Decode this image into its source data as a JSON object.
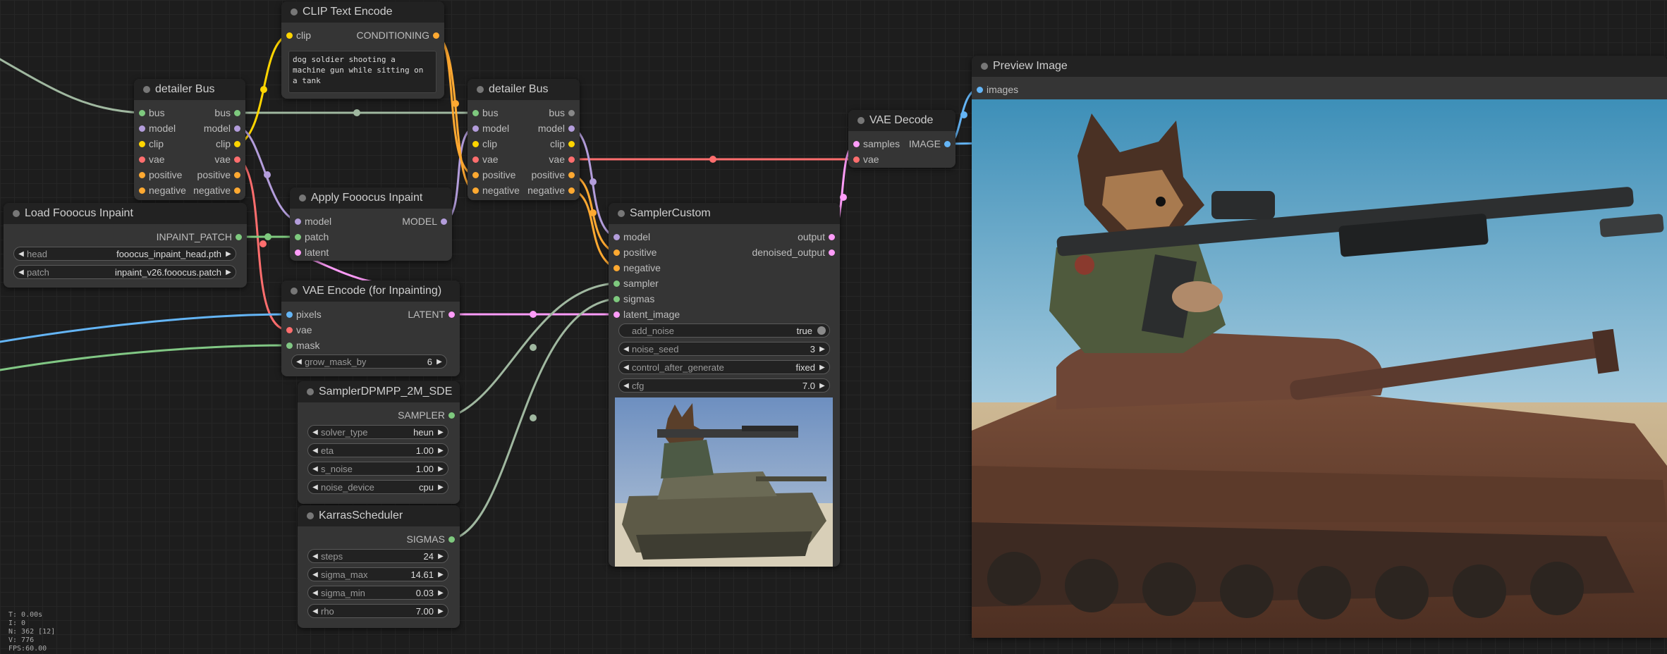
{
  "colors": {
    "bus": "#a0b8a0",
    "model": "#b39ddb",
    "clip": "#ffd500",
    "vae": "#ff6e6e",
    "conditioning": "#ffa931",
    "latent": "#ff9cf9",
    "image": "#64b5f6",
    "inpaint_patch": "#7ec97e",
    "mask": "#81c784",
    "sampler": "#a0b8a0",
    "sigmas": "#a0b8a0"
  },
  "nodes": {
    "clip_text_encode": {
      "title": "CLIP Text Encode",
      "inputs": [
        "clip"
      ],
      "outputs": [
        "CONDITIONING"
      ],
      "text": "dog soldier shooting a machine gun while sitting on a tank"
    },
    "detailer_bus_1": {
      "title": "detailer Bus",
      "inputs": [
        "bus",
        "model",
        "clip",
        "vae",
        "positive",
        "negative"
      ],
      "outputs": [
        "bus",
        "model",
        "clip",
        "vae",
        "positive",
        "negative"
      ]
    },
    "detailer_bus_2": {
      "title": "detailer Bus",
      "inputs": [
        "bus",
        "model",
        "clip",
        "vae",
        "positive",
        "negative"
      ],
      "outputs": [
        "bus",
        "model",
        "clip",
        "vae",
        "positive",
        "negative"
      ]
    },
    "load_fooocus_inpaint": {
      "title": "Load Fooocus Inpaint",
      "outputs": [
        "INPAINT_PATCH"
      ],
      "widgets": [
        {
          "label": "head",
          "value": "fooocus_inpaint_head.pth"
        },
        {
          "label": "patch",
          "value": "inpaint_v26.fooocus.patch"
        }
      ]
    },
    "apply_fooocus_inpaint": {
      "title": "Apply Fooocus Inpaint",
      "inputs": [
        "model",
        "patch",
        "latent"
      ],
      "outputs": [
        "MODEL"
      ]
    },
    "vae_encode_inpaint": {
      "title": "VAE Encode (for Inpainting)",
      "inputs": [
        "pixels",
        "vae",
        "mask"
      ],
      "outputs": [
        "LATENT"
      ],
      "widgets": [
        {
          "label": "grow_mask_by",
          "value": "6"
        }
      ]
    },
    "sampler_dpmpp": {
      "title": "SamplerDPMPP_2M_SDE",
      "outputs": [
        "SAMPLER"
      ],
      "widgets": [
        {
          "label": "solver_type",
          "value": "heun"
        },
        {
          "label": "eta",
          "value": "1.00"
        },
        {
          "label": "s_noise",
          "value": "1.00"
        },
        {
          "label": "noise_device",
          "value": "cpu"
        }
      ]
    },
    "karras_scheduler": {
      "title": "KarrasScheduler",
      "outputs": [
        "SIGMAS"
      ],
      "widgets": [
        {
          "label": "steps",
          "value": "24"
        },
        {
          "label": "sigma_max",
          "value": "14.61"
        },
        {
          "label": "sigma_min",
          "value": "0.03"
        },
        {
          "label": "rho",
          "value": "7.00"
        }
      ]
    },
    "sampler_custom": {
      "title": "SamplerCustom",
      "inputs": [
        "model",
        "positive",
        "negative",
        "sampler",
        "sigmas",
        "latent_image"
      ],
      "outputs": [
        "output",
        "denoised_output"
      ],
      "widgets": [
        {
          "label": "add_noise",
          "value": "true"
        },
        {
          "label": "noise_seed",
          "value": "3"
        },
        {
          "label": "control_after_generate",
          "value": "fixed"
        },
        {
          "label": "cfg",
          "value": "7.0"
        }
      ]
    },
    "vae_decode": {
      "title": "VAE Decode",
      "inputs": [
        "samples",
        "vae"
      ],
      "outputs": [
        "IMAGE"
      ]
    },
    "preview_image": {
      "title": "Preview Image",
      "inputs": [
        "images"
      ]
    }
  },
  "stats": [
    "T: 0.00s",
    "I: 0",
    "N: 362 [12]",
    "V: 776",
    "FPS:60.00"
  ]
}
